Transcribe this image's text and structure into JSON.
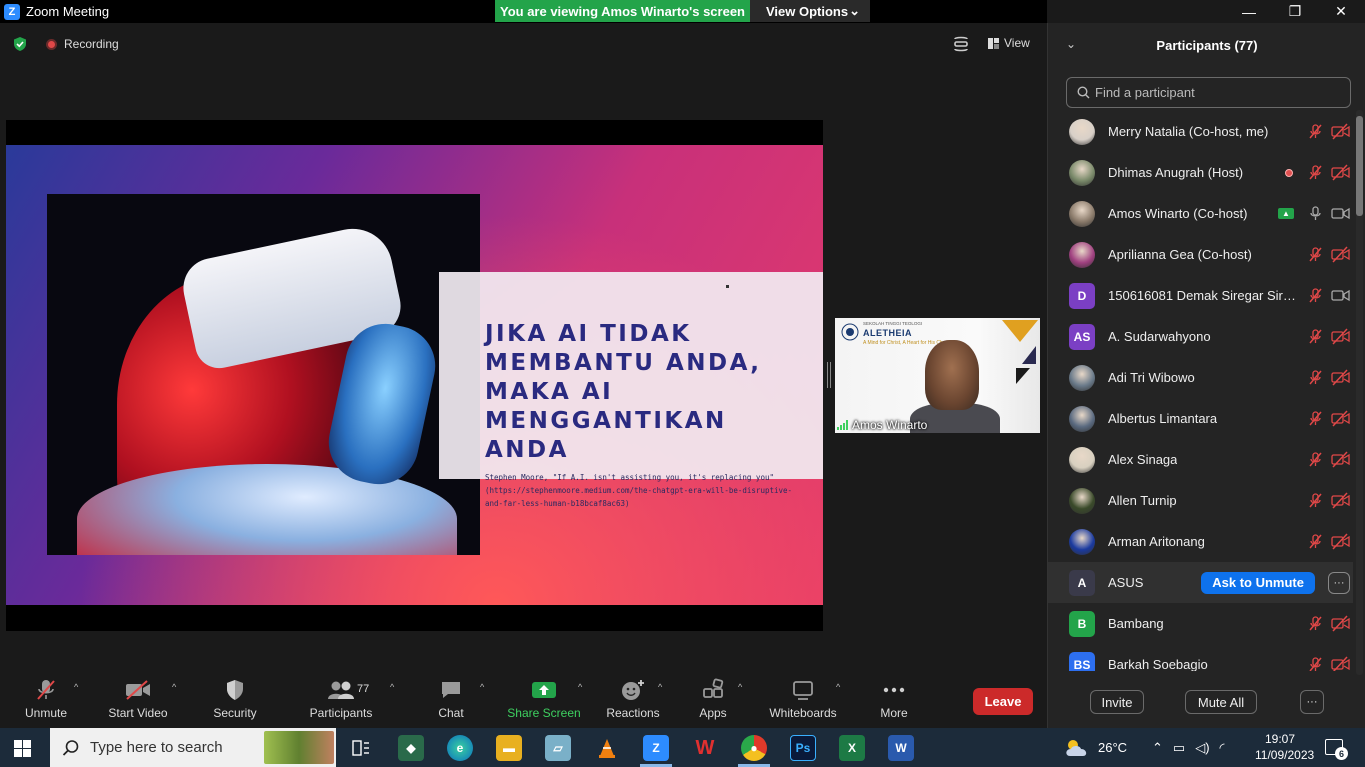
{
  "window": {
    "app_title": "Zoom Meeting",
    "viewing_banner": "You are viewing Amos Winarto's screen",
    "view_options_label": "View Options",
    "minimize": "—",
    "restore": "❐",
    "close": "✕"
  },
  "meeting": {
    "recording_label": "Recording",
    "view_label": "View"
  },
  "slide": {
    "title": "Jika AI tidak membantu Anda, maka AI menggantikan Anda",
    "source_line1": "Stephen Moore, \"If A.I. isn't assisting you, it's replacing you\"",
    "source_line2": "(https://stephenmoore.medium.com/the-chatgpt-era-will-be-disruptive-",
    "source_line3": "and-far-less-human-b18bcaf8ac63)"
  },
  "video_thumb": {
    "name": "Amos Winarto",
    "brand": "ALETHEIA",
    "school": "SEKOLAH TINGGI TEOLOGI",
    "tagline": "A Mind for Christ, A Heart for His Church"
  },
  "participants_panel": {
    "title": "Participants (77)",
    "search_placeholder": "Find a participant",
    "items": [
      {
        "name": "Merry Natalia (Co-host, me)",
        "initials": "",
        "color": "#d8d0c8",
        "status": "muted"
      },
      {
        "name": "Dhimas Anugrah (Host)",
        "initials": "",
        "color": "#7a8a6a",
        "status": "recording"
      },
      {
        "name": "Amos Winarto (Co-host)",
        "initials": "",
        "color": "#8a7a6a",
        "status": "sharing"
      },
      {
        "name": "Aprilianna Gea (Co-host)",
        "initials": "",
        "color": "#a04080",
        "status": "muted"
      },
      {
        "name": "150616081 Demak Siregar Sire...",
        "initials": "D",
        "color": "#7b3fc4",
        "status": "video"
      },
      {
        "name": "A. Sudarwahyono",
        "initials": "AS",
        "color": "#7b3fc4",
        "status": "muted"
      },
      {
        "name": "Adi Tri Wibowo",
        "initials": "",
        "color": "#6a7a8a",
        "status": "muted"
      },
      {
        "name": "Albertus Limantara",
        "initials": "",
        "color": "#5a6a80",
        "status": "muted"
      },
      {
        "name": "Alex Sinaga",
        "initials": "",
        "color": "#d8d0c0",
        "status": "muted"
      },
      {
        "name": "Allen Turnip",
        "initials": "",
        "color": "#3a4a2a",
        "status": "muted"
      },
      {
        "name": "Arman Aritonang",
        "initials": "",
        "color": "#1a3aa0",
        "status": "muted"
      },
      {
        "name": "ASUS",
        "initials": "A",
        "color": "#3a3a4a",
        "status": "ask"
      },
      {
        "name": "Bambang",
        "initials": "B",
        "color": "#23a44a",
        "status": "muted"
      },
      {
        "name": "Barkah Soebagio",
        "initials": "BS",
        "color": "#2d6ff0",
        "status": "muted"
      }
    ],
    "ask_to_unmute_label": "Ask to Unmute",
    "more_label": "···",
    "invite_label": "Invite",
    "mute_all_label": "Mute All",
    "footer_more_label": "···"
  },
  "toolbar": {
    "unmute": "Unmute",
    "start_video": "Start Video",
    "security": "Security",
    "participants": "Participants",
    "participants_count": "77",
    "chat": "Chat",
    "share_screen": "Share Screen",
    "reactions": "Reactions",
    "apps": "Apps",
    "whiteboards": "Whiteboards",
    "more": "More",
    "leave": "Leave"
  },
  "taskbar": {
    "search_placeholder": "Type here to search",
    "weather": "26°C",
    "time": "19:07",
    "date": "11/09/2023",
    "notifications": "6"
  },
  "colors": {
    "accent": "#0e72ed",
    "share_green": "#23a44a",
    "leave_red": "#cc2a2a",
    "muted_red": "#e04848"
  }
}
